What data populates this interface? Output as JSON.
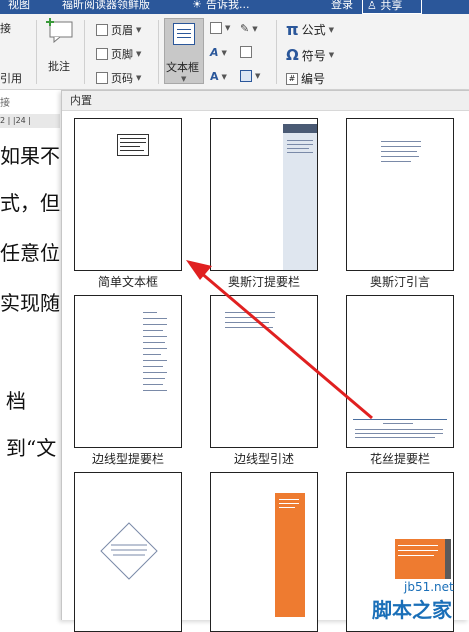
{
  "titlebar": {
    "view_tab": "视图",
    "foxit_tab": "福昕阅读器领鲜版",
    "search_hint": "告诉我...",
    "login": "登录",
    "share": "共享"
  },
  "ribbon": {
    "left_cut_1": "接",
    "left_cut_3": "引用",
    "left_cut_4": "接",
    "comment": "批注",
    "comment_group": "批",
    "header": "页眉",
    "footer": "页脚",
    "page_number": "页码",
    "textbox": "文本框",
    "equation": "公式",
    "symbol": "符号",
    "numbering": "编号"
  },
  "ruler": {
    "marks": "2 | |24 |"
  },
  "document": {
    "lines": [
      "如果不",
      "式，但是",
      "任意位",
      "实现随",
      "档",
      "到“文"
    ]
  },
  "gallery": {
    "section": "内置",
    "items": [
      "简单文本框",
      "奥斯汀提要栏",
      "奥斯汀引言",
      "边线型提要栏",
      "边线型引述",
      "花丝提要栏",
      "",
      "",
      ""
    ]
  },
  "watermark": {
    "site": "jb51.net",
    "name": "脚本之家"
  },
  "colors": {
    "ribbon_blue": "#2b579a",
    "arrow_red": "#e02020",
    "orange": "#ee7b30"
  }
}
